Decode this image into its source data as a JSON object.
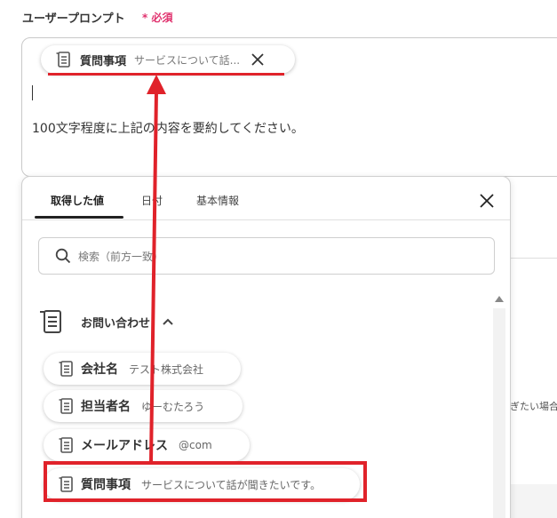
{
  "field": {
    "title": "ユーザープロンプト",
    "required_mark": "*",
    "required_label": "必須"
  },
  "editor": {
    "chip": {
      "label": "質問事項",
      "value": "サービスについて話...",
      "icon": "list-icon",
      "close_icon": "close-icon"
    },
    "text": "100文字程度に上記の内容を要約してください。"
  },
  "background": {
    "partial_text": "ぎたい場合"
  },
  "popup": {
    "tabs": [
      {
        "label": "取得した値",
        "active": true
      },
      {
        "label": "日付",
        "active": false
      },
      {
        "label": "基本情報",
        "active": false
      }
    ],
    "close_icon": "close-icon",
    "search": {
      "placeholder": "検索（前方一致）",
      "value": "",
      "icon": "search-icon"
    },
    "group": {
      "label": "お問い合わせ",
      "icon": "list-icon",
      "expanded": true
    },
    "items": [
      {
        "label": "会社名",
        "value": "テスト株式会社"
      },
      {
        "label": "担当者名",
        "value": "ゆーむたろう"
      },
      {
        "label": "メールアドレス",
        "value": "@com"
      },
      {
        "label": "質問事項",
        "value": "サービスについて話が聞きたいです。"
      }
    ]
  },
  "colors": {
    "accent_required": "#e0326e",
    "annotation_red": "#e0222a"
  }
}
